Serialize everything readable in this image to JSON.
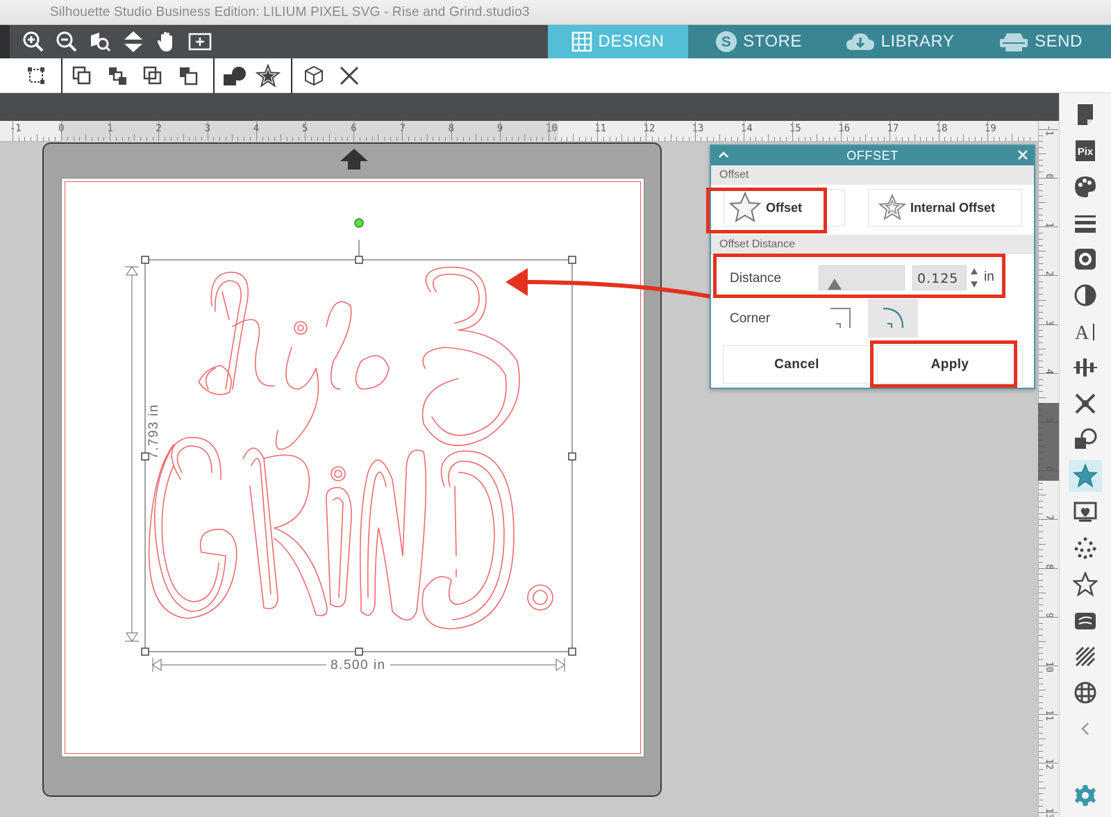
{
  "window": {
    "title": "Silhouette Studio Business Edition: LILIUM PIXEL SVG -  Rise and Grind.studio3"
  },
  "top_tabs": [
    {
      "label": "DESIGN",
      "icon": "grid-icon",
      "active": true
    },
    {
      "label": "STORE",
      "icon": "store-s-icon",
      "active": false
    },
    {
      "label": "LIBRARY",
      "icon": "cloud-library-icon",
      "active": false
    },
    {
      "label": "SEND",
      "icon": "cutter-send-icon",
      "active": false
    }
  ],
  "zoom_tools": [
    "zoom-in-icon",
    "zoom-out-icon",
    "zoom-selected-icon",
    "pan-vertical-icon",
    "hand-pan-icon",
    "fit-to-page-icon"
  ],
  "edit_tools": [
    "transform-icon",
    "bring-to-front-icon",
    "bring-forward-icon",
    "send-backward-icon",
    "send-to-back-icon",
    "modify-shapes-icon",
    "offset-star-icon",
    "3d-box-icon",
    "delete-x-icon"
  ],
  "ruler": {
    "h_labels": [
      "-1",
      "0",
      "1",
      "2",
      "3",
      "4",
      "5",
      "6",
      "7",
      "8",
      "9",
      "10",
      "11",
      "12",
      "13",
      "14",
      "15",
      "16",
      "17",
      "18",
      "19"
    ],
    "v_labels": [
      "-1",
      "0",
      "1",
      "2",
      "3",
      "4",
      "5",
      "6",
      "7",
      "8",
      "9",
      "10",
      "11",
      "12",
      "13"
    ]
  },
  "canvas": {
    "height_dim": "7.793 in",
    "width_dim": "8.500 in",
    "artwork_words": [
      "Rise &",
      "GRIND."
    ]
  },
  "offset_panel": {
    "title": "OFFSET",
    "section_offset": "Offset",
    "option_offset": "Offset",
    "option_internal": "Internal Offset",
    "section_distance": "Offset Distance",
    "distance_label": "Distance",
    "distance_value": "0.125",
    "distance_unit": "in",
    "corner_label": "Corner",
    "cancel_label": "Cancel",
    "apply_label": "Apply"
  },
  "sidebar_icons": [
    "page-setup-icon",
    "pixscan-icon",
    "fill-color-icon",
    "line-style-icon",
    "image-effects-icon",
    "contrast-icon",
    "text-style-icon",
    "align-icon",
    "replicate-icon",
    "modify-icon",
    "offset-star-icon",
    "trace-icon",
    "rhinestone-icon",
    "star-outline-icon",
    "sketch-icon",
    "fill-pattern-icon",
    "grid-icon",
    "chevron-left-icon",
    "settings-gear-icon"
  ],
  "colors": {
    "accent_teal": "#418d9c",
    "active_tab": "#53bed6",
    "highlight_red": "#e3321f",
    "cut_line": "#ea5c60"
  }
}
